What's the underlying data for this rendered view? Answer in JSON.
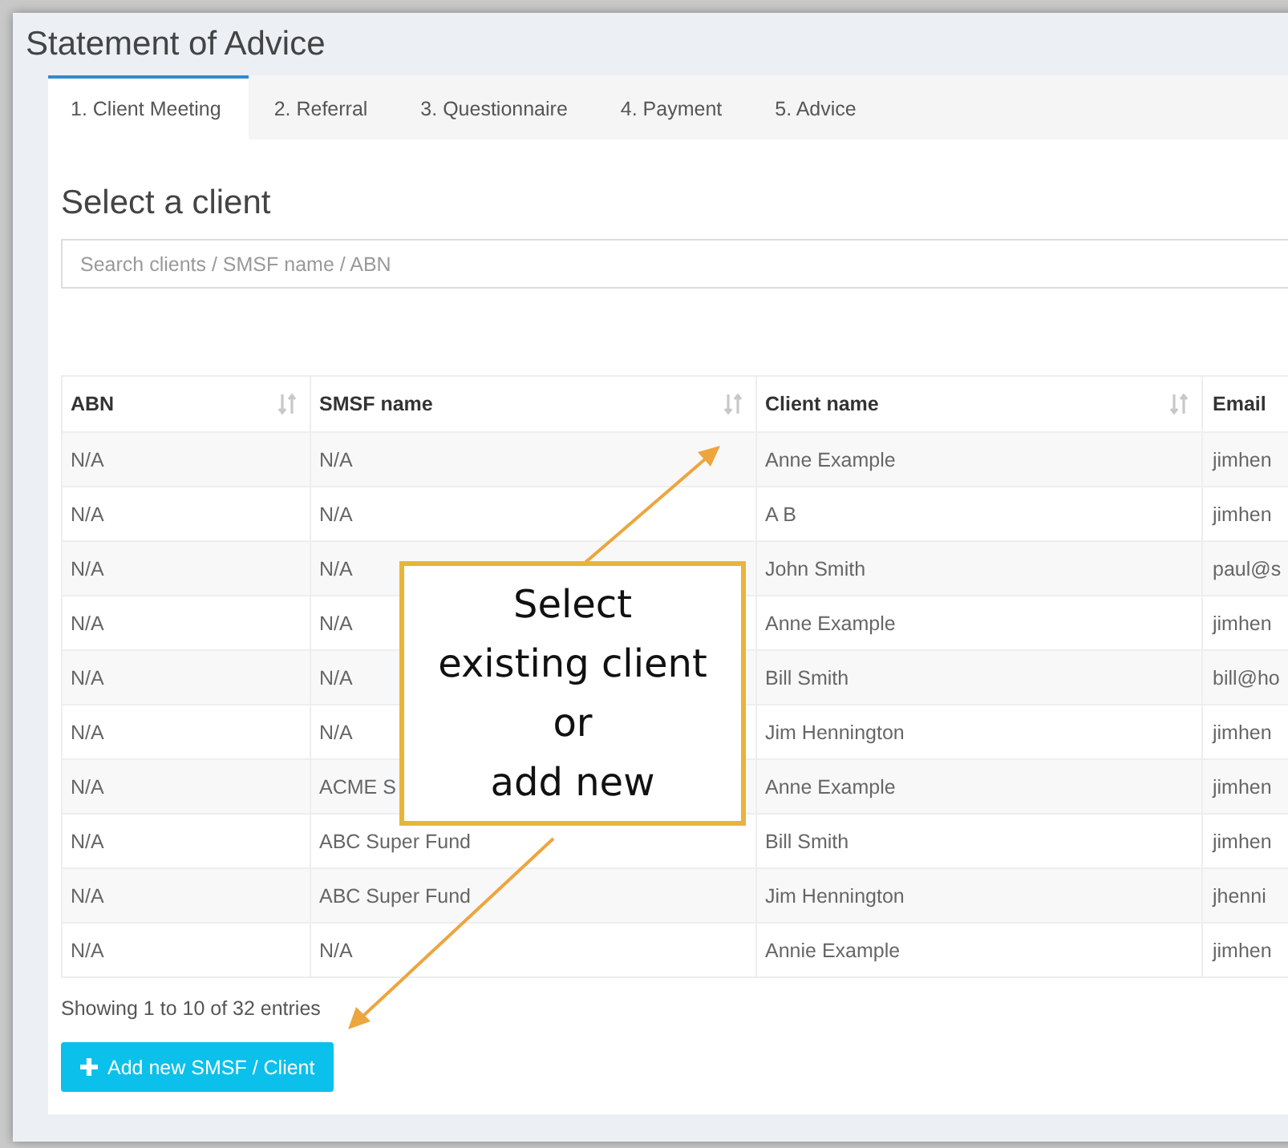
{
  "window": {
    "title": "Statement of Advice"
  },
  "tabs": [
    {
      "label": "1. Client Meeting",
      "selected": true
    },
    {
      "label": "2. Referral",
      "selected": false
    },
    {
      "label": "3. Questionnaire",
      "selected": false
    },
    {
      "label": "4. Payment",
      "selected": false
    },
    {
      "label": "5. Advice",
      "selected": false
    }
  ],
  "heading": "Select a client",
  "search": {
    "placeholder": "Search clients / SMSF name / ABN"
  },
  "table": {
    "columns": [
      {
        "label": "ABN",
        "sortable": true
      },
      {
        "label": "SMSF name",
        "sortable": true
      },
      {
        "label": "Client name",
        "sortable": true
      },
      {
        "label": "Email",
        "sortable": false
      }
    ],
    "rows": [
      [
        "N/A",
        "N/A",
        "Anne Example",
        "jimhen"
      ],
      [
        "N/A",
        "N/A",
        "A B",
        "jimhen"
      ],
      [
        "N/A",
        "N/A",
        "John Smith",
        "paul@s"
      ],
      [
        "N/A",
        "N/A",
        "Anne Example",
        "jimhen"
      ],
      [
        "N/A",
        "N/A",
        "Bill Smith",
        "bill@ho"
      ],
      [
        "N/A",
        "N/A",
        "Jim Hennington",
        "jimhen"
      ],
      [
        "N/A",
        "ACME S",
        "Anne Example",
        "jimhen"
      ],
      [
        "N/A",
        "ABC Super Fund",
        "Bill Smith",
        "jimhen"
      ],
      [
        "N/A",
        "ABC Super Fund",
        "Jim Hennington",
        "jhenni"
      ],
      [
        "N/A",
        "N/A",
        "Annie Example",
        "jimhen"
      ]
    ]
  },
  "entries_info": "Showing 1 to 10 of 32 entries",
  "add_button": {
    "label": "Add new SMSF / Client"
  },
  "callout": {
    "lines": [
      "Select",
      "existing client",
      "or",
      "add new"
    ]
  }
}
